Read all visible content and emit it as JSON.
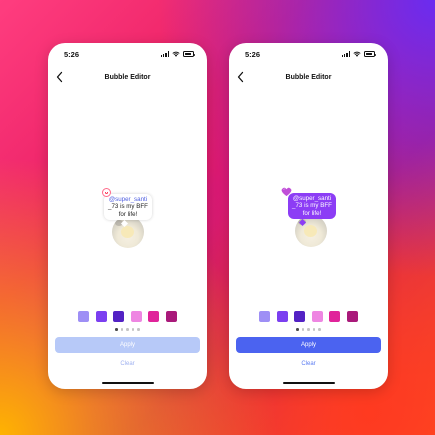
{
  "screens": [
    {
      "id": "left",
      "status": {
        "time": "5:26"
      },
      "header": {
        "title": "Bubble Editor"
      },
      "sticker": {
        "handle": "@super_santi",
        "message": "_73 is my BFF for life!"
      },
      "swatch_colors": [
        "#9e8ff5",
        "#7b3ff0",
        "#5322c4",
        "#ee86e2",
        "#e0239a",
        "#a9197a"
      ],
      "pager": {
        "count": 5,
        "active": 1
      },
      "apply_button": {
        "label": "Apply",
        "enabled": false
      },
      "clear_button": {
        "label": "Clear"
      }
    },
    {
      "id": "right",
      "status": {
        "time": "5:26"
      },
      "header": {
        "title": "Bubble Editor"
      },
      "sticker": {
        "handle": "@super_santi",
        "message": "_73 is my BFF for life!"
      },
      "swatch_colors": [
        "#9e8ff5",
        "#7b3ff0",
        "#5322c4",
        "#ee86e2",
        "#e0239a",
        "#a9197a"
      ],
      "pager": {
        "count": 5,
        "active": 1
      },
      "apply_button": {
        "label": "Apply",
        "enabled": true
      },
      "clear_button": {
        "label": "Clear"
      }
    }
  ],
  "colors": {
    "bubble_selected": "#8c3df5",
    "apply_enabled": "#4b63f0",
    "apply_disabled": "#b7c9f8"
  },
  "icons": {
    "back": "chevron-left-icon",
    "badge_left": "smiley-icon",
    "badge_right": "heart-icon"
  }
}
